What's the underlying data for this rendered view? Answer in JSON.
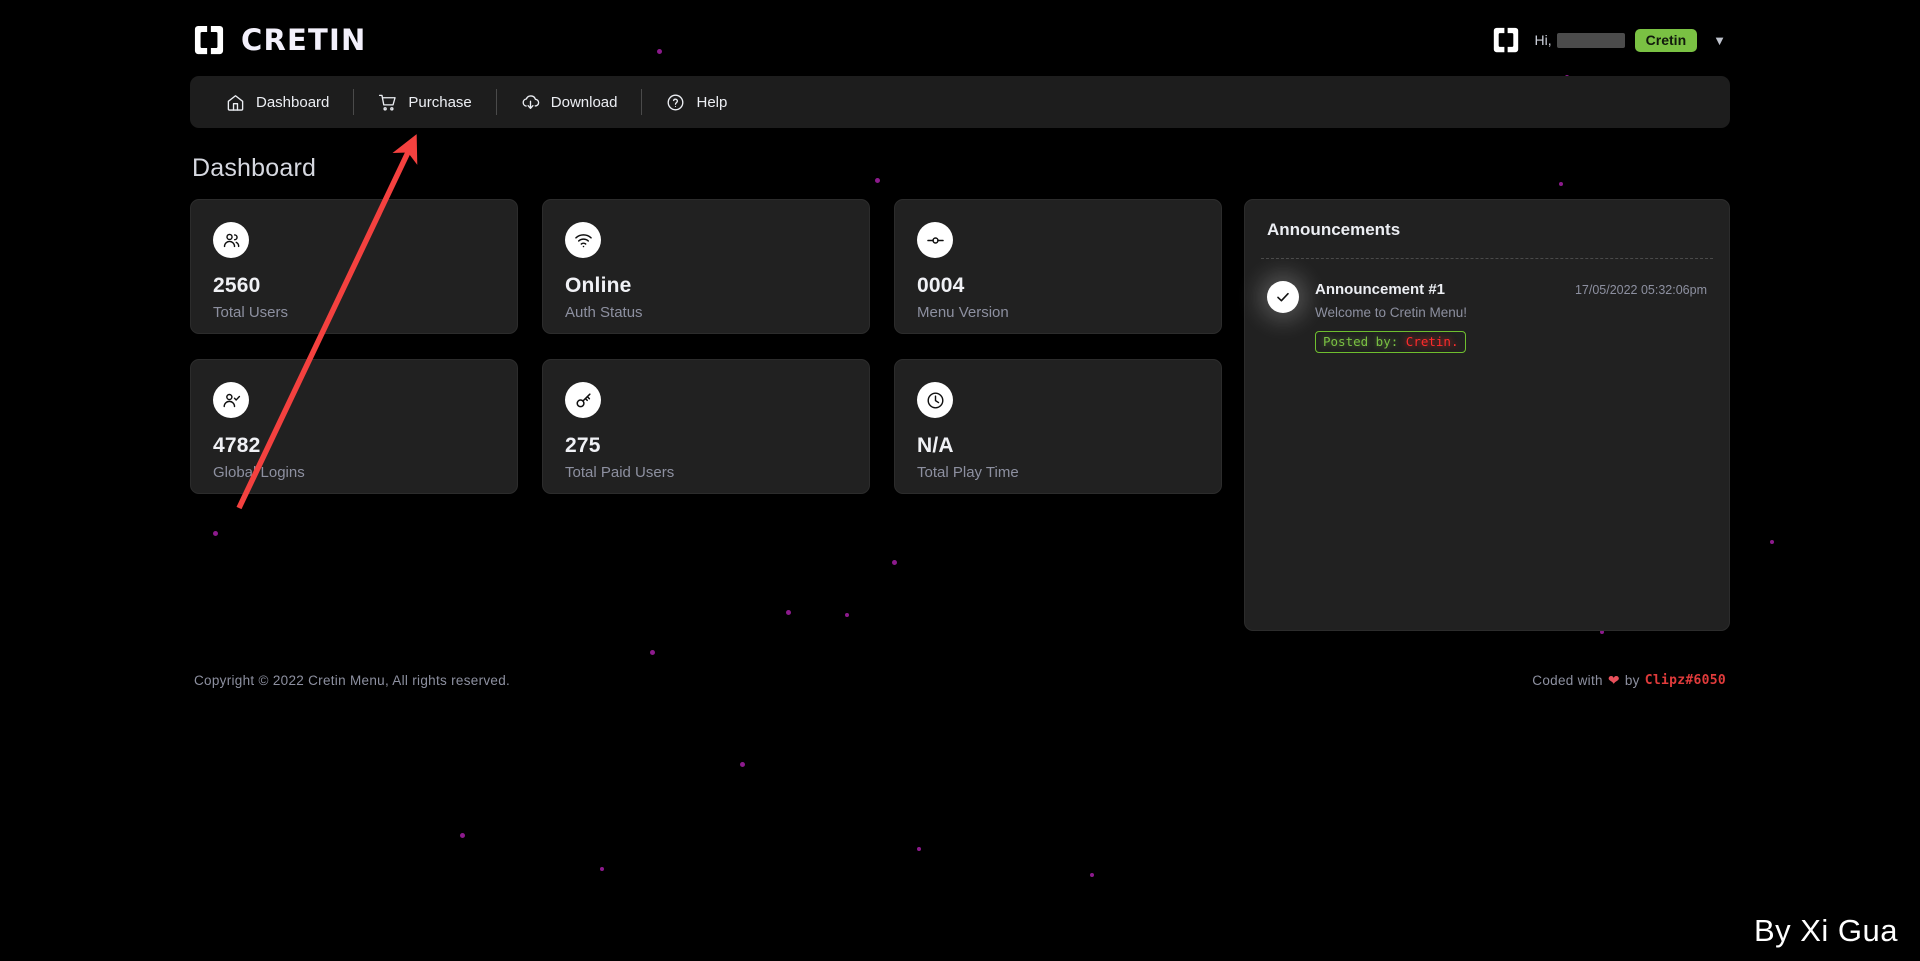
{
  "header": {
    "brand_name": "CRETIN",
    "brand_logo_icon": "cretin-logo-icon",
    "user_logo_icon": "cretin-logo-icon",
    "greeting": "Hi,",
    "greeting_redacted": true,
    "rank_badge": "Cretin",
    "chevron_icon": "chevron-down-icon"
  },
  "nav": {
    "items": [
      {
        "label": "Dashboard",
        "icon": "home-icon"
      },
      {
        "label": "Purchase",
        "icon": "cart-icon"
      },
      {
        "label": "Download",
        "icon": "cloud-download-icon"
      },
      {
        "label": "Help",
        "icon": "question-circle-icon"
      }
    ]
  },
  "page": {
    "title": "Dashboard"
  },
  "stats": [
    {
      "value": "2560",
      "label": "Total Users",
      "icon": "users-icon"
    },
    {
      "value": "Online",
      "label": "Auth Status",
      "icon": "wifi-icon"
    },
    {
      "value": "0004",
      "label": "Menu Version",
      "icon": "git-commit-icon"
    },
    {
      "value": "4782",
      "label": "Global Logins",
      "icon": "user-check-icon"
    },
    {
      "value": "275",
      "label": "Total Paid Users",
      "icon": "key-icon"
    },
    {
      "value": "N/A",
      "label": "Total Play Time",
      "icon": "clock-icon"
    }
  ],
  "announcements": {
    "title": "Announcements",
    "items": [
      {
        "status_icon": "check-circle-icon",
        "heading": "Announcement #1",
        "date": "17/05/2022 05:32:06pm",
        "text": "Welcome to Cretin Menu!",
        "posted_by_label": "Posted by:",
        "posted_by_name": "Cretin."
      }
    ]
  },
  "footer": {
    "copyright": "Copyright © 2022 Cretin Menu, All rights reserved.",
    "coded_with": "Coded with",
    "heart_icon": "heart-icon",
    "by": "by",
    "coder": "Clipz#6050"
  },
  "watermark": "By Xi Gua",
  "colors": {
    "background": "#000000",
    "surface": "#212121",
    "navbar": "#1d1d1d",
    "accent_green": "#7ac143",
    "accent_red": "#ff2b2b",
    "text_primary": "#eceef3",
    "text_muted": "#8d90a0",
    "annotation_arrow": "#f4413f",
    "particle": "#8c1a8c"
  }
}
